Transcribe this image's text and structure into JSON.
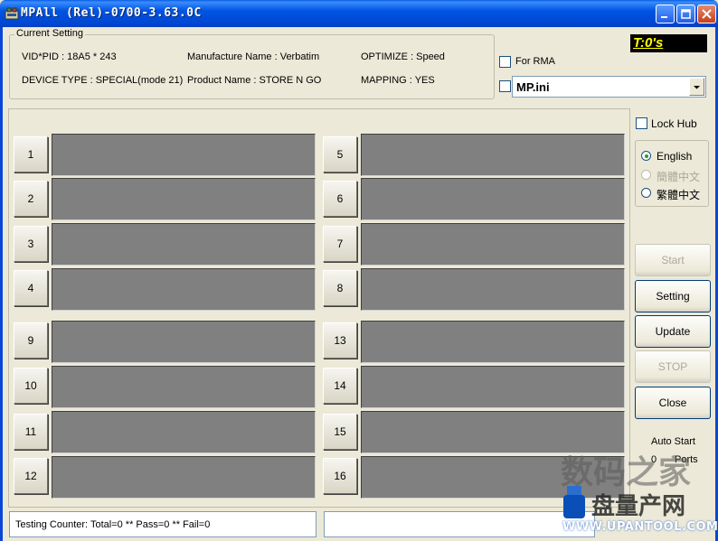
{
  "window": {
    "title": "MPAll (Rel)-0700-3.63.0C",
    "timer": "T:0's"
  },
  "current_setting": {
    "legend": "Current Setting",
    "vid_pid": "VID*PID : 18A5 * 243",
    "manufacture": "Manufacture Name : Verbatim",
    "optimize": "OPTIMIZE : Speed",
    "device_type": "DEVICE TYPE : SPECIAL(mode 21)",
    "product": "Product Name : STORE N GO",
    "mapping": "MAPPING : YES"
  },
  "options": {
    "for_rma": "For RMA",
    "ini_file": "MP.ini",
    "lock_hub": "Lock Hub"
  },
  "languages": [
    "English",
    "簡體中文",
    "繁體中文"
  ],
  "ports": [
    "1",
    "2",
    "3",
    "4",
    "5",
    "6",
    "7",
    "8",
    "9",
    "10",
    "11",
    "12",
    "13",
    "14",
    "15",
    "16"
  ],
  "actions": {
    "start": "Start",
    "setting": "Setting",
    "update": "Update",
    "stop": "STOP",
    "close": "Close"
  },
  "auto_start": {
    "label": "Auto Start",
    "value": "0",
    "unit": "Ports"
  },
  "status": {
    "counter": "Testing Counter: Total=0 ** Pass=0 ** Fail=0",
    "message": ""
  },
  "watermark": {
    "line1": "数码之家",
    "line2": "盘量产网",
    "line3": "WWW.UPANTOOL.COM"
  },
  "colors": {
    "titlebar": "#0054e3",
    "port_box": "#808080",
    "timer_text": "#ffff00"
  }
}
